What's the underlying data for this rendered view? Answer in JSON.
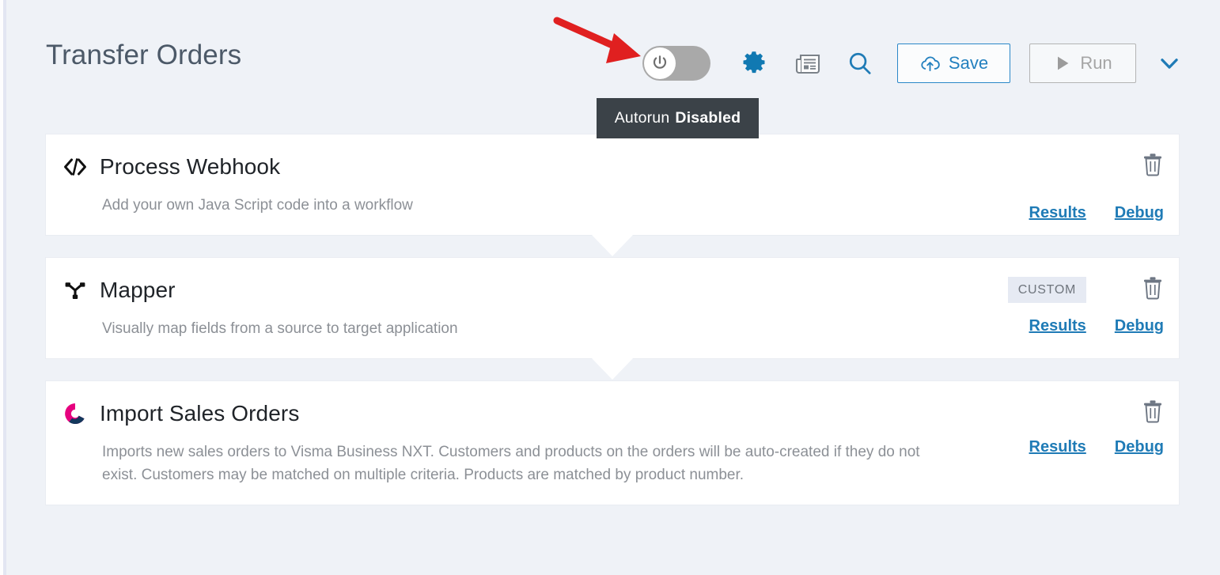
{
  "header": {
    "title": "Transfer Orders",
    "toggle": {
      "name": "autorun-toggle",
      "state": "off",
      "track_color": "#a9a9a9"
    },
    "tooltip": {
      "label": "Autorun",
      "value": "Disabled",
      "background": "#3b4248"
    },
    "icons": [
      {
        "name": "gear-icon",
        "color": "#1179b2"
      },
      {
        "name": "report-icon",
        "color": "#7b8289"
      },
      {
        "name": "search-icon",
        "color": "#1f7bb6"
      }
    ],
    "buttons": {
      "save": {
        "label": "Save",
        "icon": "cloud-upload-icon",
        "border": "#2a87c8",
        "color": "#2380bf"
      },
      "run": {
        "label": "Run",
        "icon": "play-icon",
        "border": "#b4b4b4",
        "color": "#a5a5a5",
        "disabled": true
      },
      "chevron": {
        "name": "chevron-down-icon",
        "color": "#1f7bb6"
      }
    },
    "annotation": {
      "name": "red-arrow",
      "color": "#e02020",
      "points_to": "autorun-toggle"
    }
  },
  "steps": [
    {
      "icon": "code-brackets-icon",
      "title": "Process Webhook",
      "description": "Add your own Java Script code into a workflow",
      "badge": null,
      "results_label": "Results",
      "debug_label": "Debug",
      "delete_icon": "trash-icon"
    },
    {
      "icon": "merge-icon",
      "title": "Mapper",
      "description": "Visually map fields from a source to target application",
      "badge": "CUSTOM",
      "results_label": "Results",
      "debug_label": "Debug",
      "delete_icon": "trash-icon"
    },
    {
      "icon": "visma-logo-icon",
      "title": "Import Sales Orders",
      "description": "Imports new sales orders to Visma Business NXT. Customers and products on the orders will be auto-created if they do not exist. Customers may be matched on multiple criteria. Products are matched by product number.",
      "badge": null,
      "results_label": "Results",
      "debug_label": "Debug",
      "delete_icon": "trash-icon"
    }
  ],
  "colors": {
    "page_background": "#eff2f7",
    "card_background": "#ffffff",
    "title_text": "#4c5968",
    "link_blue": "#1f7bb6",
    "badge_background": "#e6eaf3",
    "visma_pink": "#e6007e",
    "visma_navy": "#13385c"
  }
}
